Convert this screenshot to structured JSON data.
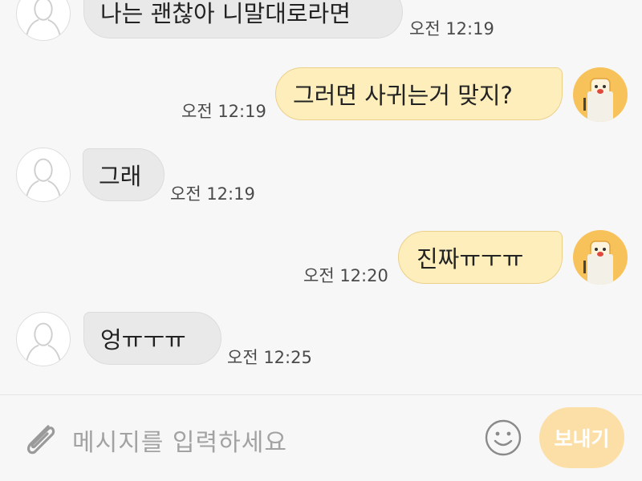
{
  "messages": [
    {
      "side": "left",
      "text": "나는 괜찮아 니말대로라면",
      "time": "오전 12:19"
    },
    {
      "side": "right",
      "text": "그러면 사귀는거 맞지?",
      "time": "오전 12:19"
    },
    {
      "side": "left",
      "text": "그래",
      "time": "오전 12:19"
    },
    {
      "side": "right",
      "text": "진짜ㅠㅜㅠ",
      "time": "오전 12:20"
    },
    {
      "side": "left",
      "text": "엉ㅠㅜㅠ",
      "time": "오전 12:25"
    }
  ],
  "input": {
    "placeholder": "메시지를 입력하세요"
  },
  "send_button": {
    "label": "보내기"
  },
  "icons": {
    "attach": "paperclip-icon",
    "emoji": "smiley-icon",
    "friend_avatar": "person-silhouette-icon",
    "my_avatar": "toast-character-icon"
  },
  "colors": {
    "my_bubble": "#fdeebc",
    "their_bubble": "#e9e9e9",
    "send_button": "#fbdfa7",
    "background": "#f7f7f7"
  }
}
